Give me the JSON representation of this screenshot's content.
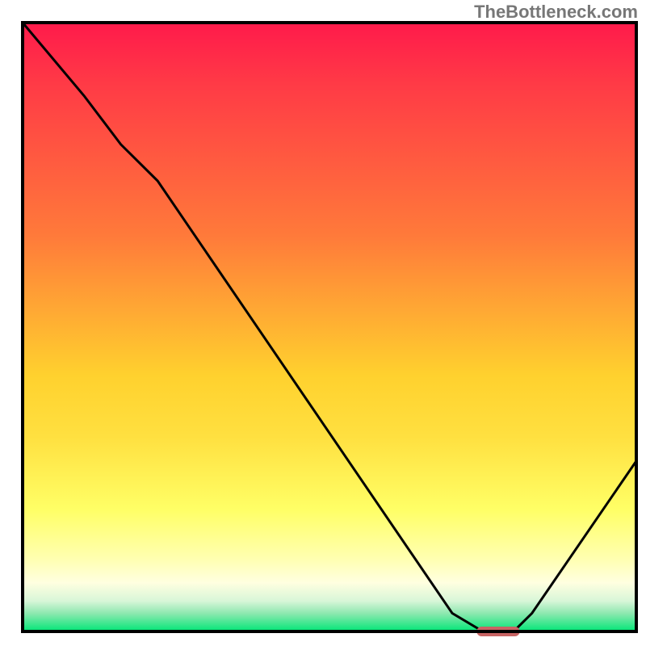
{
  "attribution": "TheBottleneck.com",
  "colors": {
    "gradient_top": "#ff1a4b",
    "gradient_upper_mid": "#ff7a3a",
    "gradient_mid": "#ffd12e",
    "gradient_lower_mid": "#ffff66",
    "gradient_light": "#ffffd0",
    "gradient_green_pale": "#b8f0c8",
    "gradient_green": "#00e676",
    "curve": "#000000",
    "marker": "#c86464",
    "frame": "#000000"
  },
  "chart_data": {
    "type": "line",
    "title": "",
    "xlabel": "",
    "ylabel": "",
    "xlim": [
      0,
      100
    ],
    "ylim": [
      0,
      100
    ],
    "series": [
      {
        "name": "bottleneck-curve",
        "x": [
          0,
          10,
          16,
          22,
          70,
          75,
          80,
          83,
          100
        ],
        "values": [
          100,
          88,
          80,
          74,
          3,
          0,
          0,
          3,
          28
        ]
      }
    ],
    "annotations": [
      {
        "name": "optimal-marker",
        "x_start": 74,
        "x_end": 81,
        "y": 0
      }
    ],
    "background_bands_pct_from_top": [
      {
        "color": "#ff1a4b",
        "stop": 0
      },
      {
        "color": "#ff3a46",
        "stop": 10
      },
      {
        "color": "#ff7a3a",
        "stop": 35
      },
      {
        "color": "#ffd12e",
        "stop": 58
      },
      {
        "color": "#ffe040",
        "stop": 68
      },
      {
        "color": "#ffff66",
        "stop": 80
      },
      {
        "color": "#ffffb0",
        "stop": 88
      },
      {
        "color": "#ffffe0",
        "stop": 92
      },
      {
        "color": "#d8f6d8",
        "stop": 95
      },
      {
        "color": "#8ee8b0",
        "stop": 97
      },
      {
        "color": "#00e676",
        "stop": 100
      }
    ]
  }
}
